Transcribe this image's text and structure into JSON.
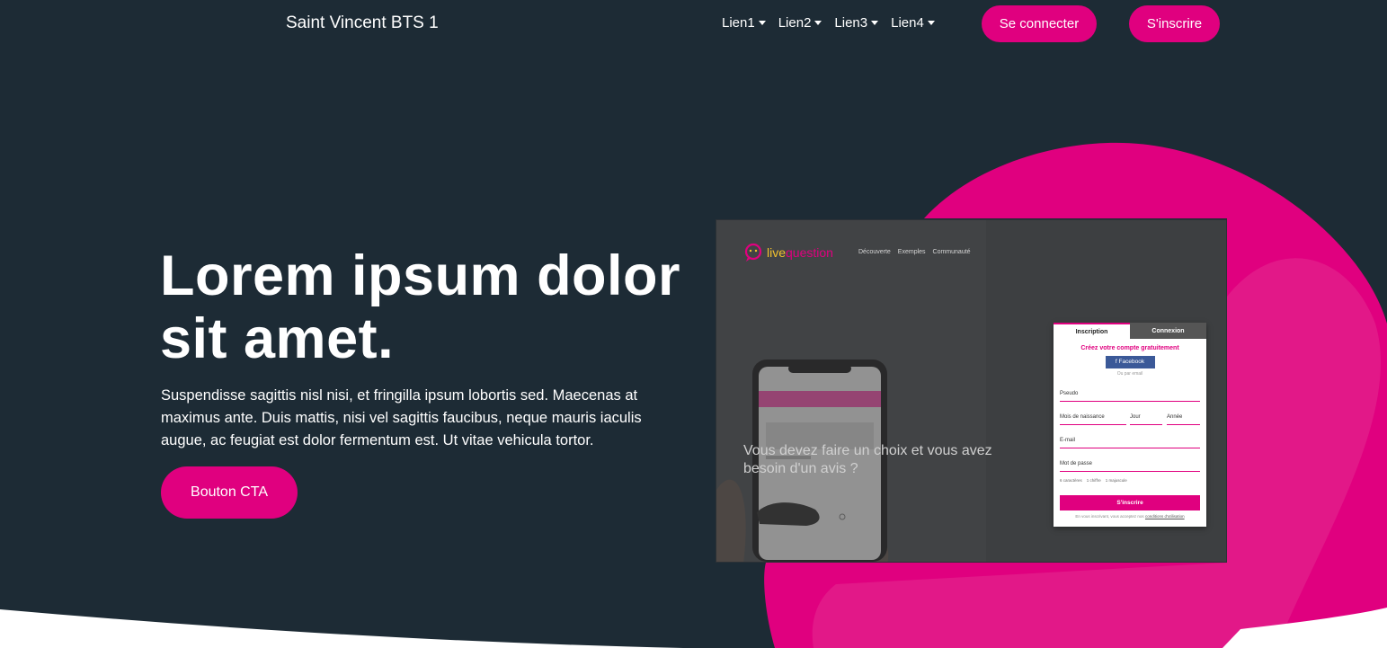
{
  "navbar": {
    "brand": "Saint Vincent BTS 1",
    "links": [
      "Lien1",
      "Lien2",
      "Lien3",
      "Lien4"
    ],
    "login_label": "Se connecter",
    "signup_label": "S'inscrire"
  },
  "hero": {
    "title": "Lorem ipsum dolor sit amet.",
    "text": "Suspendisse sagittis nisl nisi, et fringilla ipsum lobortis sed. Maecenas at maximus ante. Duis mattis, nisi vel sagittis faucibus, neque mauris iaculis augue, ac feugiat est dolor fermentum est. Ut vitae vehicula tortor.",
    "cta_label": "Bouton CTA"
  },
  "mockup": {
    "logo_live": "live",
    "logo_question": "question",
    "nav": [
      "Découverte",
      "Exemples",
      "Communauté"
    ],
    "tagline": "Vous devez faire un choix et vous avez besoin d'un avis ?",
    "form": {
      "tab_signup": "Inscription",
      "tab_login": "Connexion",
      "title": "Créez votre compte gratuitement",
      "facebook": "Facebook",
      "or_email": "Ou par email",
      "pseudo": "Pseudo",
      "birth_month": "Mois de naissance",
      "day": "Jour",
      "year": "Année",
      "email": "E-mail",
      "password": "Mot de passe",
      "hints": [
        "6 caractères",
        "1 chiffre",
        "1 majuscule"
      ],
      "submit": "S'inscrire",
      "legal_prefix": "En vous inscrivant, vous acceptez nos",
      "legal_link": "conditions d'utilisation"
    }
  },
  "colors": {
    "background": "#1d2b35",
    "accent": "#e0007f"
  }
}
